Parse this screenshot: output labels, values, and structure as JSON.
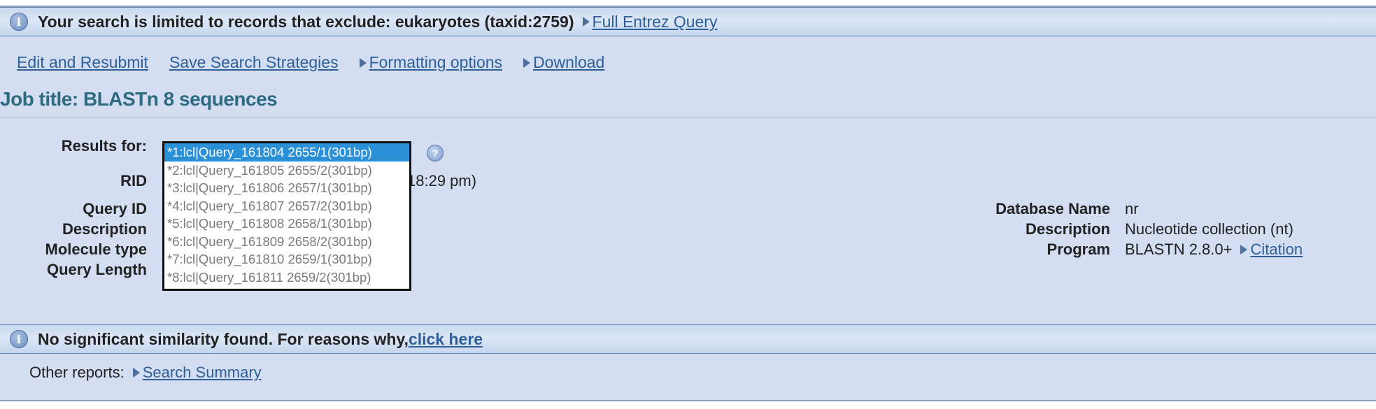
{
  "limit_banner": {
    "text": "Your search is limited to records that exclude: eukaryotes (taxid:2759)",
    "link": "Full Entrez Query"
  },
  "toolbar": {
    "edit_resubmit": "Edit and Resubmit",
    "save_strategies": "Save Search Strategies",
    "formatting_options": "Formatting options",
    "download": "Download"
  },
  "job_title": "Job title: BLASTn 8 sequences",
  "results_for": {
    "label": "Results for:",
    "options": [
      "*1:lcl|Query_161804 2655/1(301bp)",
      "*2:lcl|Query_161805 2655/2(301bp)",
      "*3:lcl|Query_161806 2657/1(301bp)",
      "*4:lcl|Query_161807 2657/2(301bp)",
      "*5:lcl|Query_161808 2658/1(301bp)",
      "*6:lcl|Query_161809 2658/2(301bp)",
      "*7:lcl|Query_161810 2659/1(301bp)",
      "*8:lcl|Query_161811 2659/2(301bp)"
    ],
    "selected_index": 0
  },
  "left_fields": {
    "rid_label": "RID",
    "rid_value_tail": "18:29 pm)",
    "query_id_label": "Query ID",
    "description_label": "Description",
    "molecule_type_label": "Molecule type",
    "query_length_label": "Query Length"
  },
  "right_fields": {
    "database_name_label": "Database Name",
    "database_name_value": "nr",
    "description_label": "Description",
    "description_value": "Nucleotide collection (nt)",
    "program_label": "Program",
    "program_value": "BLASTN 2.8.0+",
    "citation_link": "Citation"
  },
  "no_similarity_banner": {
    "text": "No significant similarity found. For reasons why,",
    "link": "click here"
  },
  "other_reports": {
    "label": "Other reports:",
    "link": "Search Summary"
  },
  "icons": {
    "info": "info-icon",
    "help": "help-icon",
    "expand": "triangle-right-icon"
  },
  "colors": {
    "panel_bg": "#d3def3",
    "link": "#2f5f98",
    "title": "#2e6a80",
    "selected_option": "#2a90d8"
  }
}
